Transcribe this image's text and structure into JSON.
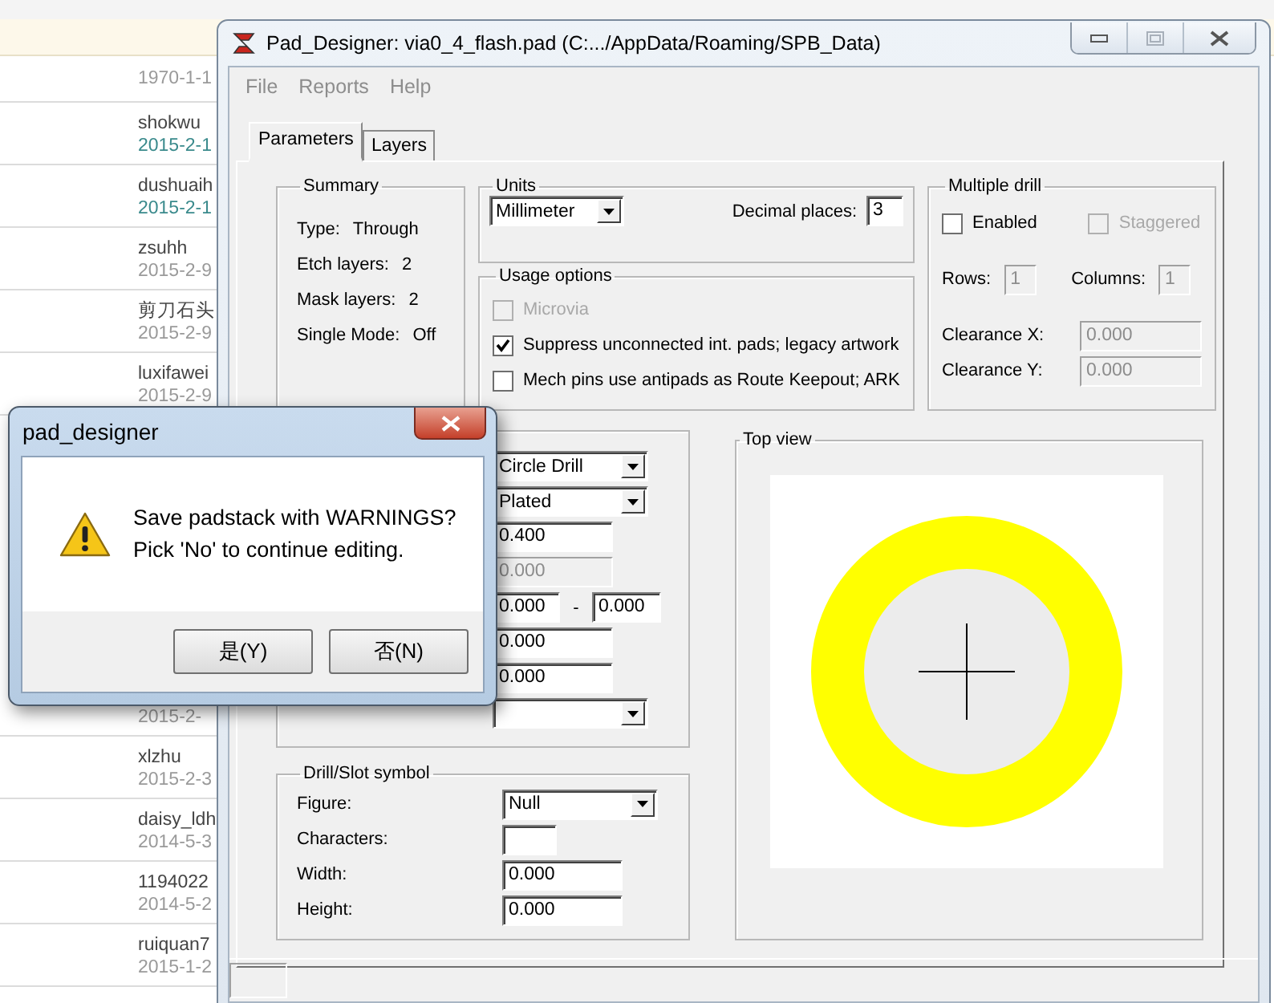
{
  "background_page": {
    "list_top": [
      {
        "date": "1970-1-1",
        "color": "#9a9a9a"
      },
      {
        "name": "shokwu",
        "date": "2015-2-1",
        "color": "#3a8a8c"
      },
      {
        "name": "dushuaih",
        "date": "2015-2-1",
        "color": "#3a8a8c"
      },
      {
        "name": "zsuhh",
        "date": "2015-2-9",
        "color": "#9a9a9a"
      },
      {
        "name": "剪刀石头",
        "date": "2015-2-9",
        "color": "#9a9a9a"
      },
      {
        "name": "luxifawei",
        "date": "2015-2-9",
        "color": "#9a9a9a"
      }
    ],
    "list_bottom": [
      {
        "date": "2015-2-",
        "color": "#9a9a9a"
      },
      {
        "name": "xlzhu",
        "date": "2015-2-3",
        "color": "#9a9a9a"
      },
      {
        "name": "daisy_ldh",
        "date": "2014-5-3",
        "color": "#9a9a9a"
      },
      {
        "name": "1194022",
        "date": "2014-5-2",
        "color": "#9a9a9a"
      },
      {
        "name": "ruiquan7",
        "date": "2015-1-2",
        "color": "#9a9a9a"
      }
    ]
  },
  "window": {
    "title": "Pad_Designer: via0_4_flash.pad (C:.../AppData/Roaming/SPB_Data)",
    "menu": [
      {
        "label": "File",
        "disabled": true
      },
      {
        "label": "Reports",
        "disabled": true
      },
      {
        "label": "Help",
        "disabled": true
      }
    ],
    "tabs": [
      {
        "label": "Parameters",
        "selected": true
      },
      {
        "label": "Layers",
        "selected": false
      }
    ],
    "summary": {
      "title": "Summary",
      "rows": [
        {
          "label": "Type:",
          "value": "Through"
        },
        {
          "label": "Etch layers:",
          "value": "2"
        },
        {
          "label": "Mask layers:",
          "value": "2"
        },
        {
          "label": "Single Mode:",
          "value": "Off"
        }
      ]
    },
    "units": {
      "title": "Units",
      "unit": "Millimeter",
      "decimal_label": "Decimal places:",
      "decimal_value": "3"
    },
    "usage_options": {
      "title": "Usage options",
      "options": [
        {
          "label": "Microvia",
          "checked": false,
          "disabled": true
        },
        {
          "label": "Suppress unconnected int. pads; legacy artwork",
          "checked": true,
          "disabled": false
        },
        {
          "label": "Mech pins use antipads as Route Keepout; ARK",
          "checked": false,
          "disabled": false
        }
      ]
    },
    "multiple_drill": {
      "title": "Multiple drill",
      "enabled": {
        "label": "Enabled",
        "checked": false,
        "disabled": false
      },
      "staggered": {
        "label": "Staggered",
        "checked": false,
        "disabled": true
      },
      "rows_label": "Rows:",
      "rows_value": "1",
      "columns_label": "Columns:",
      "columns_value": "1",
      "clearance": [
        {
          "label": "Clearance X:",
          "value": "0.000"
        },
        {
          "label": "Clearance Y:",
          "value": "0.000"
        }
      ]
    },
    "drill_hole": {
      "fields": [
        {
          "kind": "dropdown",
          "value": "Circle Drill",
          "disabled": false
        },
        {
          "kind": "dropdown",
          "value": "Plated",
          "disabled": false
        },
        {
          "kind": "field",
          "value": "0.400",
          "disabled": false
        },
        {
          "kind": "field",
          "value": "0.000",
          "disabled": true
        },
        {
          "kind": "range",
          "value": "0.000",
          "separator": "-",
          "value2": "0.000",
          "disabled": false
        },
        {
          "kind": "field",
          "value": "0.000",
          "disabled": false
        },
        {
          "kind": "field",
          "value": "0.000",
          "disabled": false
        },
        {
          "kind": "dropdown",
          "disabled": false
        }
      ]
    },
    "drill_slot_symbol": {
      "title": "Drill/Slot symbol",
      "rows": [
        {
          "label": "Figure:",
          "kind": "dropdown",
          "value": "Null"
        },
        {
          "label": "Characters:",
          "kind": "short_field"
        },
        {
          "label": "Width:",
          "kind": "field",
          "value": "0.000"
        },
        {
          "label": "Height:",
          "kind": "field",
          "value": "0.000"
        }
      ]
    },
    "top_view": {
      "title": "Top view"
    }
  },
  "dialog": {
    "title": "pad_designer",
    "message": [
      "Save padstack with WARNINGS?",
      "Pick 'No' to continue editing."
    ],
    "buttons": [
      {
        "label": "是(Y)"
      },
      {
        "label": "否(N)"
      }
    ]
  }
}
